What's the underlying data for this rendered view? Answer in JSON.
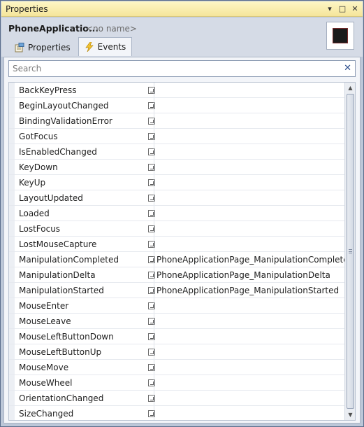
{
  "window": {
    "title": "Properties",
    "controls": {
      "pin_icon": "▾",
      "maximize_icon": "□",
      "close_icon": "✕"
    }
  },
  "header": {
    "object_name": "PhoneApplicatio...",
    "object_label": "<no name>",
    "preview_color": "#1a1a1a"
  },
  "tabs": [
    {
      "label": "Properties",
      "icon": "properties-icon",
      "active": false
    },
    {
      "label": "Events",
      "icon": "lightning-icon",
      "active": true
    }
  ],
  "search": {
    "placeholder": "Search",
    "value": "",
    "clear_icon": "✕"
  },
  "events": [
    {
      "name": "BackKeyPress",
      "handler": ""
    },
    {
      "name": "BeginLayoutChanged",
      "handler": ""
    },
    {
      "name": "BindingValidationError",
      "handler": ""
    },
    {
      "name": "GotFocus",
      "handler": ""
    },
    {
      "name": "IsEnabledChanged",
      "handler": ""
    },
    {
      "name": "KeyDown",
      "handler": ""
    },
    {
      "name": "KeyUp",
      "handler": ""
    },
    {
      "name": "LayoutUpdated",
      "handler": ""
    },
    {
      "name": "Loaded",
      "handler": ""
    },
    {
      "name": "LostFocus",
      "handler": ""
    },
    {
      "name": "LostMouseCapture",
      "handler": ""
    },
    {
      "name": "ManipulationCompleted",
      "handler": "PhoneApplicationPage_ManipulationCompleted"
    },
    {
      "name": "ManipulationDelta",
      "handler": "PhoneApplicationPage_ManipulationDelta"
    },
    {
      "name": "ManipulationStarted",
      "handler": "PhoneApplicationPage_ManipulationStarted"
    },
    {
      "name": "MouseEnter",
      "handler": ""
    },
    {
      "name": "MouseLeave",
      "handler": ""
    },
    {
      "name": "MouseLeftButtonDown",
      "handler": ""
    },
    {
      "name": "MouseLeftButtonUp",
      "handler": ""
    },
    {
      "name": "MouseMove",
      "handler": ""
    },
    {
      "name": "MouseWheel",
      "handler": ""
    },
    {
      "name": "OrientationChanged",
      "handler": ""
    },
    {
      "name": "SizeChanged",
      "handler": ""
    }
  ]
}
